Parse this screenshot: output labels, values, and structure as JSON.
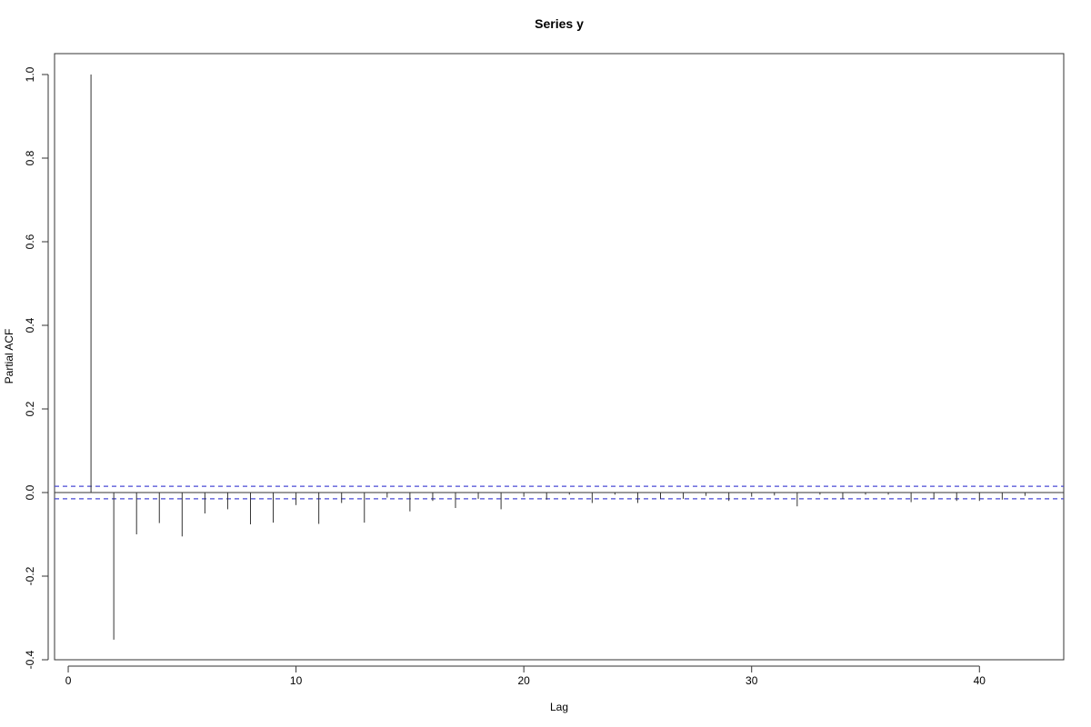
{
  "chart_data": {
    "type": "bar",
    "title": "Series  y",
    "xlabel": "Lag",
    "ylabel": "Partial ACF",
    "xlim": [
      -0.6,
      43.7
    ],
    "ylim": [
      -0.4,
      1.05
    ],
    "xticks": [
      0,
      10,
      20,
      30,
      40
    ],
    "xtick_labels": [
      "0",
      "10",
      "20",
      "30",
      "40"
    ],
    "yticks": [
      -0.4,
      -0.2,
      0.0,
      0.2,
      0.4,
      0.6,
      0.8,
      1.0
    ],
    "ytick_labels": [
      "-0.4",
      "-0.2",
      "0.0",
      "0.2",
      "0.4",
      "0.6",
      "0.8",
      "1.0"
    ],
    "confidence_bound": 0.015,
    "series": [
      {
        "lags": [
          1,
          2,
          3,
          4,
          5,
          6,
          7,
          8,
          9,
          10,
          11,
          12,
          13,
          14,
          15,
          16,
          17,
          18,
          19,
          20,
          21,
          22,
          23,
          24,
          25,
          26,
          27,
          28,
          29,
          30,
          31,
          32,
          33,
          34,
          35,
          36,
          37,
          38,
          39,
          40,
          41,
          42
        ],
        "values": [
          1.0,
          -0.352,
          -0.1,
          -0.073,
          -0.105,
          -0.05,
          -0.04,
          -0.076,
          -0.072,
          -0.03,
          -0.075,
          -0.025,
          -0.072,
          -0.012,
          -0.045,
          -0.02,
          -0.037,
          -0.015,
          -0.04,
          -0.01,
          -0.017,
          -0.005,
          -0.025,
          -0.005,
          -0.025,
          -0.015,
          -0.015,
          -0.008,
          -0.02,
          -0.01,
          -0.007,
          -0.033,
          -0.005,
          -0.015,
          -0.005,
          -0.005,
          -0.023,
          -0.015,
          -0.02,
          -0.02,
          -0.017,
          -0.008
        ]
      }
    ],
    "colors": {
      "bars": "#333333",
      "zero_line": "#333333",
      "confidence_lines": "#4a4ad6",
      "frame": "#333333"
    }
  }
}
